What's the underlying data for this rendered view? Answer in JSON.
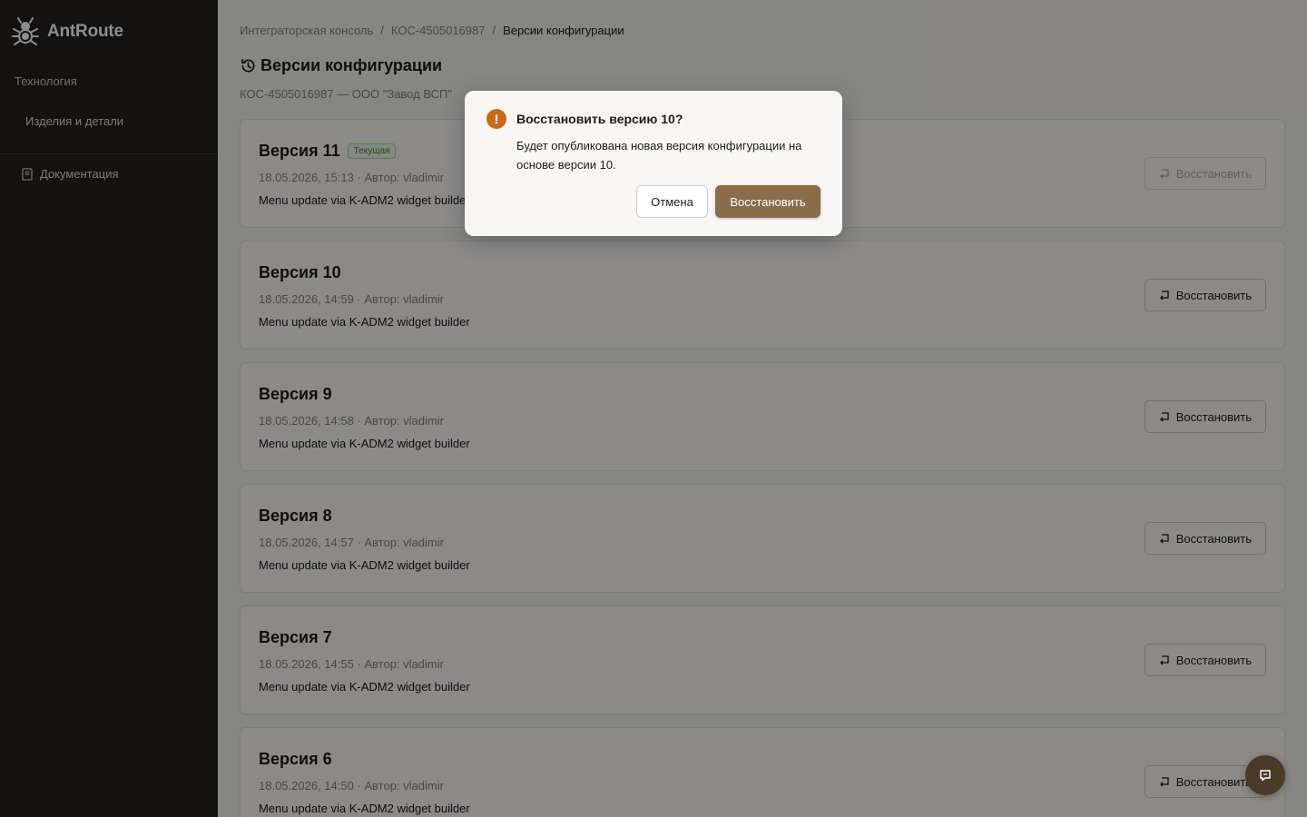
{
  "app": {
    "name": "AntRoute"
  },
  "sidebar": {
    "section_label": "Технология",
    "items": [
      {
        "label": "Изделия и детали"
      }
    ],
    "docs_label": "Документация"
  },
  "breadcrumb": [
    "Интеграторская консоль",
    "КОС-4505016987",
    "Версии конфигурации"
  ],
  "breadcrumb_separator": "/",
  "page": {
    "title": "Версии конфигурации",
    "subtitle": "КОС-4505016987 — ООО \"Завод ВСП\""
  },
  "versions": [
    {
      "title": "Версия 11",
      "badge": "Текущая",
      "meta": "18.05.2026, 15:13 · Автор: vladimir",
      "description": "Menu update via K-ADM2 widget builder",
      "button_label": "Восстановить",
      "button_disabled": true
    },
    {
      "title": "Версия 10",
      "badge": "",
      "meta": "18.05.2026, 14:59 · Автор: vladimir",
      "description": "Menu update via K-ADM2 widget builder",
      "button_label": "Восстановить",
      "button_disabled": false
    },
    {
      "title": "Версия 9",
      "badge": "",
      "meta": "18.05.2026, 14:58 · Автор: vladimir",
      "description": "Menu update via K-ADM2 widget builder",
      "button_label": "Восстановить",
      "button_disabled": false
    },
    {
      "title": "Версия 8",
      "badge": "",
      "meta": "18.05.2026, 14:57 · Автор: vladimir",
      "description": "Menu update via K-ADM2 widget builder",
      "button_label": "Восстановить",
      "button_disabled": false
    },
    {
      "title": "Версия 7",
      "badge": "",
      "meta": "18.05.2026, 14:55 · Автор: vladimir",
      "description": "Menu update via K-ADM2 widget builder",
      "button_label": "Восстановить",
      "button_disabled": false
    },
    {
      "title": "Версия 6",
      "badge": "",
      "meta": "18.05.2026, 14:50 · Автор: vladimir",
      "description": "Menu update via K-ADM2 widget builder",
      "button_label": "Восстановить",
      "button_disabled": false
    }
  ],
  "modal": {
    "icon": "warning-icon",
    "icon_glyph": "!",
    "title": "Восстановить версию 10?",
    "text": "Будет опубликована новая версия конфигурации на основе версии 10.",
    "cancel_label": "Отмена",
    "confirm_label": "Восстановить"
  },
  "colors": {
    "sidebar_bg": "#23211f",
    "accent": "#8b6d4c",
    "warning": "#c96a1b",
    "badge_green": "#3f8a3f"
  }
}
